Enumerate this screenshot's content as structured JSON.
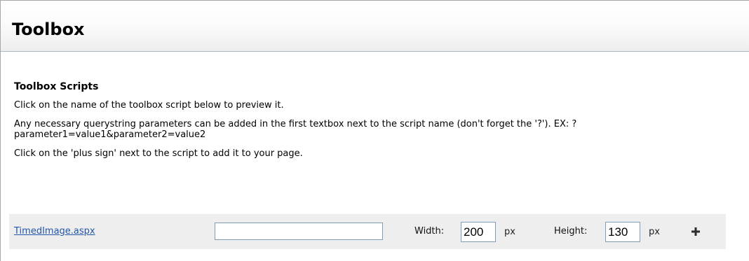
{
  "header": {
    "title": "Toolbox"
  },
  "section": {
    "title": "Toolbox Scripts",
    "instructions": [
      "Click on the name of the toolbox script below to preview it.",
      "Any necessary querystring parameters can be added in the first textbox next to the script name (don't forget the '?'). EX: ?parameter1=value1&parameter2=value2",
      "Click on the 'plus sign' next to the script to add it to your page."
    ]
  },
  "scripts": [
    {
      "name": "TimedImage.aspx",
      "querystring_value": "",
      "width_label": "Width:",
      "width_value": "200",
      "width_unit": "px",
      "height_label": "Height:",
      "height_value": "130",
      "height_unit": "px",
      "add_icon": "plus-icon"
    }
  ],
  "colors": {
    "link": "#2355a8",
    "row_background": "#eeeeee",
    "header_border": "#a8b4c7"
  }
}
